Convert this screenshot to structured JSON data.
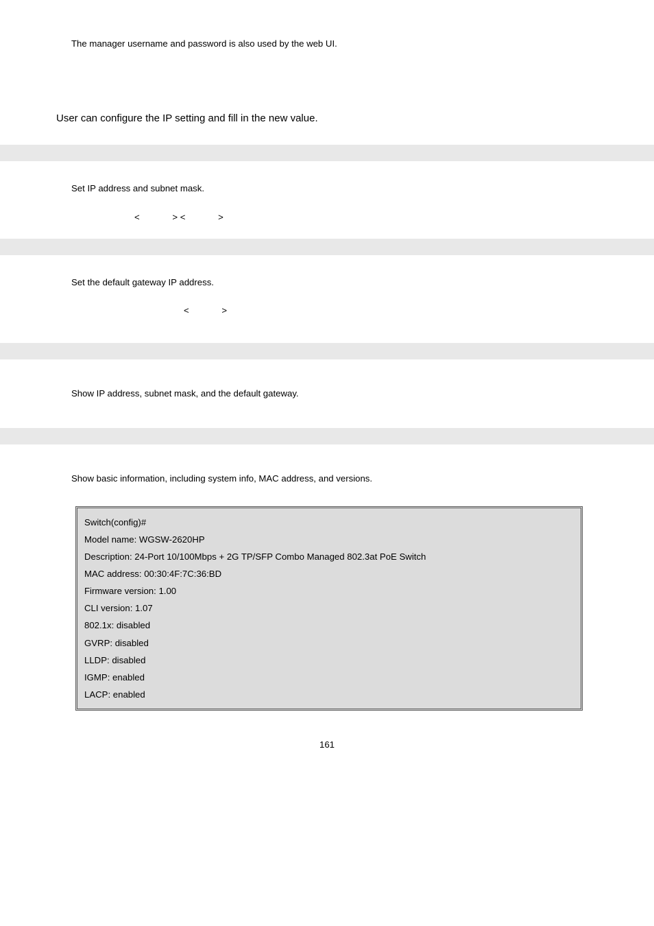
{
  "intro": {
    "note": "The manager username and password is also used by the web UI.",
    "heading": "User can configure the IP setting and fill in the new value."
  },
  "section1": {
    "desc": "Set IP address and subnet mask.",
    "syntax_lt1": "<",
    "syntax_gt_lt": "> <",
    "syntax_gt2": ">"
  },
  "section2": {
    "desc": "Set the default gateway IP address.",
    "syntax_lt": "<",
    "syntax_gt": ">"
  },
  "section3": {
    "desc": "Show IP address, subnet mask, and the default gateway."
  },
  "section4": {
    "desc": "Show basic information, including system info, MAC address, and versions."
  },
  "info_box": {
    "l0": "Switch(config)#",
    "l1": "Model name: WGSW-2620HP",
    "l2": "Description: 24-Port 10/100Mbps + 2G TP/SFP Combo Managed 802.3at PoE Switch",
    "l3": "MAC address: 00:30:4F:7C:36:BD",
    "l4": "Firmware version: 1.00",
    "l5": "CLI version: 1.07",
    "l6": "802.1x: disabled",
    "l7": "GVRP: disabled",
    "l8": "LLDP: disabled",
    "l9": "IGMP: enabled",
    "l10": "LACP: enabled"
  },
  "page_number": "161"
}
